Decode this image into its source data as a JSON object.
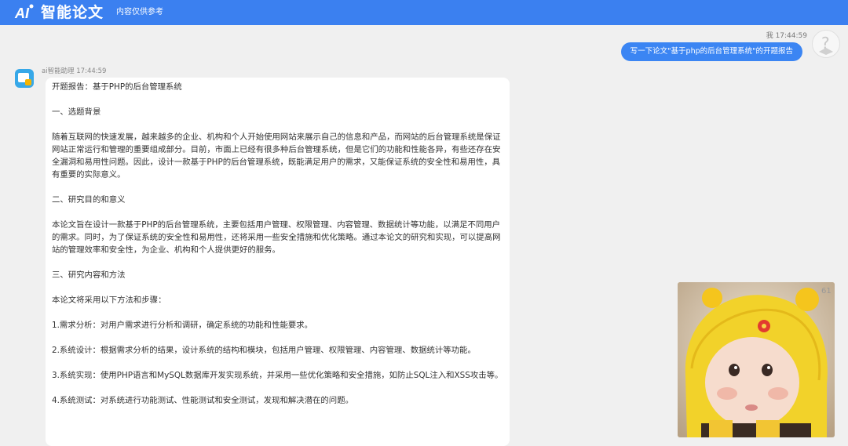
{
  "header": {
    "logo_text": "AI",
    "title": "智能论文",
    "note": "内容仅供参考"
  },
  "user_message": {
    "meta": "我 17:44:59",
    "text": "写一下论文\"基于php的后台管理系统\"的开题报告"
  },
  "ai_message": {
    "meta": "ai智能助理 17:44:59",
    "paragraphs": [
      "开题报告：基于PHP的后台管理系统",
      "一、选题背景",
      "随着互联网的快速发展，越来越多的企业、机构和个人开始使用网站来展示自己的信息和产品，而网站的后台管理系统是保证网站正常运行和管理的重要组成部分。目前，市面上已经有很多种后台管理系统，但是它们的功能和性能各异，有些还存在安全漏洞和易用性问题。因此，设计一款基于PHP的后台管理系统，既能满足用户的需求，又能保证系统的安全性和易用性，具有重要的实际意义。",
      "二、研究目的和意义",
      "本论文旨在设计一款基于PHP的后台管理系统，主要包括用户管理、权限管理、内容管理、数据统计等功能，以满足不同用户的需求。同时，为了保证系统的安全性和易用性，还将采用一些安全措施和优化策略。通过本论文的研究和实现，可以提高网站的管理效率和安全性，为企业、机构和个人提供更好的服务。",
      "三、研究内容和方法",
      "本论文将采用以下方法和步骤：",
      "1.需求分析：对用户需求进行分析和调研，确定系统的功能和性能要求。",
      "2.系统设计：根据需求分析的结果，设计系统的结构和模块，包括用户管理、权限管理、内容管理、数据统计等功能。",
      "3.系统实现：使用PHP语言和MySQL数据库开发实现系统，并采用一些优化策略和安全措施，如防止SQL注入和XSS攻击等。",
      "4.系统测试：对系统进行功能测试、性能测试和安全测试，发现和解决潜在的问题。"
    ]
  },
  "photo": {
    "watermark": "61",
    "description_icon": "baby-in-bee-hat-photo"
  },
  "colors": {
    "header": "#3b80f0",
    "user_bubble": "#3b85f3",
    "background": "#f0f0f0"
  }
}
